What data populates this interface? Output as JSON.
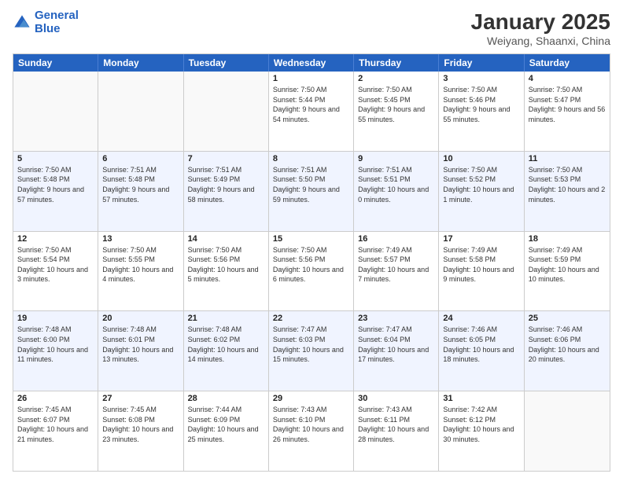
{
  "header": {
    "logo_line1": "General",
    "logo_line2": "Blue",
    "title": "January 2025",
    "subtitle": "Weiyang, Shaanxi, China"
  },
  "days_of_week": [
    "Sunday",
    "Monday",
    "Tuesday",
    "Wednesday",
    "Thursday",
    "Friday",
    "Saturday"
  ],
  "weeks": [
    {
      "alt": false,
      "days": [
        {
          "num": "",
          "sunrise": "",
          "sunset": "",
          "daylight": ""
        },
        {
          "num": "",
          "sunrise": "",
          "sunset": "",
          "daylight": ""
        },
        {
          "num": "",
          "sunrise": "",
          "sunset": "",
          "daylight": ""
        },
        {
          "num": "1",
          "sunrise": "Sunrise: 7:50 AM",
          "sunset": "Sunset: 5:44 PM",
          "daylight": "Daylight: 9 hours and 54 minutes."
        },
        {
          "num": "2",
          "sunrise": "Sunrise: 7:50 AM",
          "sunset": "Sunset: 5:45 PM",
          "daylight": "Daylight: 9 hours and 55 minutes."
        },
        {
          "num": "3",
          "sunrise": "Sunrise: 7:50 AM",
          "sunset": "Sunset: 5:46 PM",
          "daylight": "Daylight: 9 hours and 55 minutes."
        },
        {
          "num": "4",
          "sunrise": "Sunrise: 7:50 AM",
          "sunset": "Sunset: 5:47 PM",
          "daylight": "Daylight: 9 hours and 56 minutes."
        }
      ]
    },
    {
      "alt": true,
      "days": [
        {
          "num": "5",
          "sunrise": "Sunrise: 7:50 AM",
          "sunset": "Sunset: 5:48 PM",
          "daylight": "Daylight: 9 hours and 57 minutes."
        },
        {
          "num": "6",
          "sunrise": "Sunrise: 7:51 AM",
          "sunset": "Sunset: 5:48 PM",
          "daylight": "Daylight: 9 hours and 57 minutes."
        },
        {
          "num": "7",
          "sunrise": "Sunrise: 7:51 AM",
          "sunset": "Sunset: 5:49 PM",
          "daylight": "Daylight: 9 hours and 58 minutes."
        },
        {
          "num": "8",
          "sunrise": "Sunrise: 7:51 AM",
          "sunset": "Sunset: 5:50 PM",
          "daylight": "Daylight: 9 hours and 59 minutes."
        },
        {
          "num": "9",
          "sunrise": "Sunrise: 7:51 AM",
          "sunset": "Sunset: 5:51 PM",
          "daylight": "Daylight: 10 hours and 0 minutes."
        },
        {
          "num": "10",
          "sunrise": "Sunrise: 7:50 AM",
          "sunset": "Sunset: 5:52 PM",
          "daylight": "Daylight: 10 hours and 1 minute."
        },
        {
          "num": "11",
          "sunrise": "Sunrise: 7:50 AM",
          "sunset": "Sunset: 5:53 PM",
          "daylight": "Daylight: 10 hours and 2 minutes."
        }
      ]
    },
    {
      "alt": false,
      "days": [
        {
          "num": "12",
          "sunrise": "Sunrise: 7:50 AM",
          "sunset": "Sunset: 5:54 PM",
          "daylight": "Daylight: 10 hours and 3 minutes."
        },
        {
          "num": "13",
          "sunrise": "Sunrise: 7:50 AM",
          "sunset": "Sunset: 5:55 PM",
          "daylight": "Daylight: 10 hours and 4 minutes."
        },
        {
          "num": "14",
          "sunrise": "Sunrise: 7:50 AM",
          "sunset": "Sunset: 5:56 PM",
          "daylight": "Daylight: 10 hours and 5 minutes."
        },
        {
          "num": "15",
          "sunrise": "Sunrise: 7:50 AM",
          "sunset": "Sunset: 5:56 PM",
          "daylight": "Daylight: 10 hours and 6 minutes."
        },
        {
          "num": "16",
          "sunrise": "Sunrise: 7:49 AM",
          "sunset": "Sunset: 5:57 PM",
          "daylight": "Daylight: 10 hours and 7 minutes."
        },
        {
          "num": "17",
          "sunrise": "Sunrise: 7:49 AM",
          "sunset": "Sunset: 5:58 PM",
          "daylight": "Daylight: 10 hours and 9 minutes."
        },
        {
          "num": "18",
          "sunrise": "Sunrise: 7:49 AM",
          "sunset": "Sunset: 5:59 PM",
          "daylight": "Daylight: 10 hours and 10 minutes."
        }
      ]
    },
    {
      "alt": true,
      "days": [
        {
          "num": "19",
          "sunrise": "Sunrise: 7:48 AM",
          "sunset": "Sunset: 6:00 PM",
          "daylight": "Daylight: 10 hours and 11 minutes."
        },
        {
          "num": "20",
          "sunrise": "Sunrise: 7:48 AM",
          "sunset": "Sunset: 6:01 PM",
          "daylight": "Daylight: 10 hours and 13 minutes."
        },
        {
          "num": "21",
          "sunrise": "Sunrise: 7:48 AM",
          "sunset": "Sunset: 6:02 PM",
          "daylight": "Daylight: 10 hours and 14 minutes."
        },
        {
          "num": "22",
          "sunrise": "Sunrise: 7:47 AM",
          "sunset": "Sunset: 6:03 PM",
          "daylight": "Daylight: 10 hours and 15 minutes."
        },
        {
          "num": "23",
          "sunrise": "Sunrise: 7:47 AM",
          "sunset": "Sunset: 6:04 PM",
          "daylight": "Daylight: 10 hours and 17 minutes."
        },
        {
          "num": "24",
          "sunrise": "Sunrise: 7:46 AM",
          "sunset": "Sunset: 6:05 PM",
          "daylight": "Daylight: 10 hours and 18 minutes."
        },
        {
          "num": "25",
          "sunrise": "Sunrise: 7:46 AM",
          "sunset": "Sunset: 6:06 PM",
          "daylight": "Daylight: 10 hours and 20 minutes."
        }
      ]
    },
    {
      "alt": false,
      "days": [
        {
          "num": "26",
          "sunrise": "Sunrise: 7:45 AM",
          "sunset": "Sunset: 6:07 PM",
          "daylight": "Daylight: 10 hours and 21 minutes."
        },
        {
          "num": "27",
          "sunrise": "Sunrise: 7:45 AM",
          "sunset": "Sunset: 6:08 PM",
          "daylight": "Daylight: 10 hours and 23 minutes."
        },
        {
          "num": "28",
          "sunrise": "Sunrise: 7:44 AM",
          "sunset": "Sunset: 6:09 PM",
          "daylight": "Daylight: 10 hours and 25 minutes."
        },
        {
          "num": "29",
          "sunrise": "Sunrise: 7:43 AM",
          "sunset": "Sunset: 6:10 PM",
          "daylight": "Daylight: 10 hours and 26 minutes."
        },
        {
          "num": "30",
          "sunrise": "Sunrise: 7:43 AM",
          "sunset": "Sunset: 6:11 PM",
          "daylight": "Daylight: 10 hours and 28 minutes."
        },
        {
          "num": "31",
          "sunrise": "Sunrise: 7:42 AM",
          "sunset": "Sunset: 6:12 PM",
          "daylight": "Daylight: 10 hours and 30 minutes."
        },
        {
          "num": "",
          "sunrise": "",
          "sunset": "",
          "daylight": ""
        }
      ]
    }
  ]
}
